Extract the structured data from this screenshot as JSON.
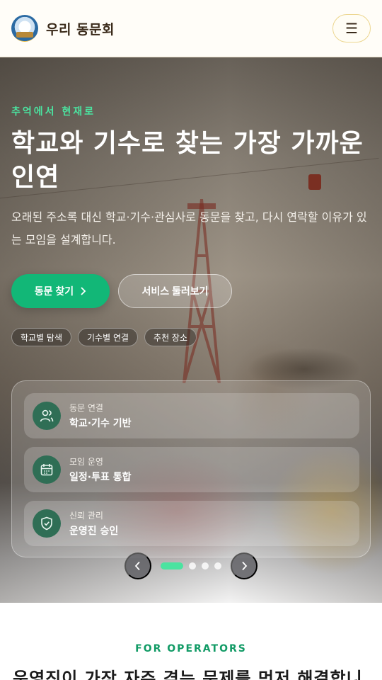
{
  "header": {
    "brand": "우리 동문회",
    "menu_icon": "☰"
  },
  "hero": {
    "eyebrow": "추억에서 현재로",
    "title": "학교와 기수로 찾는 가장 가까운 인연",
    "description": "오래된 주소록 대신 학교·기수·관심사로 동문을 찾고, 다시 연락할 이유가 있는 모임을 설계합니다.",
    "primary_button": "동문 찾기",
    "secondary_button": "서비스 둘러보기",
    "chips": [
      "학교별 탐색",
      "기수별 연결",
      "추천 장소"
    ],
    "cards": [
      {
        "label": "동문 연결",
        "value": "학교·기수 기반",
        "icon": "users-icon"
      },
      {
        "label": "모임 운영",
        "value": "일정·투표 통합",
        "icon": "calendar-icon"
      },
      {
        "label": "신뢰 관리",
        "value": "운영진 승인",
        "icon": "shield-check-icon"
      }
    ],
    "carousel": {
      "total": 4,
      "active": 1
    }
  },
  "operators": {
    "eyebrow": "FOR OPERATORS",
    "title": "운영진이 가장 자주 겪는 문제를 먼저 해결합니"
  },
  "colors": {
    "accent": "#12b777",
    "accent_light": "#4be3a0",
    "menu_border": "#ecd68f"
  }
}
